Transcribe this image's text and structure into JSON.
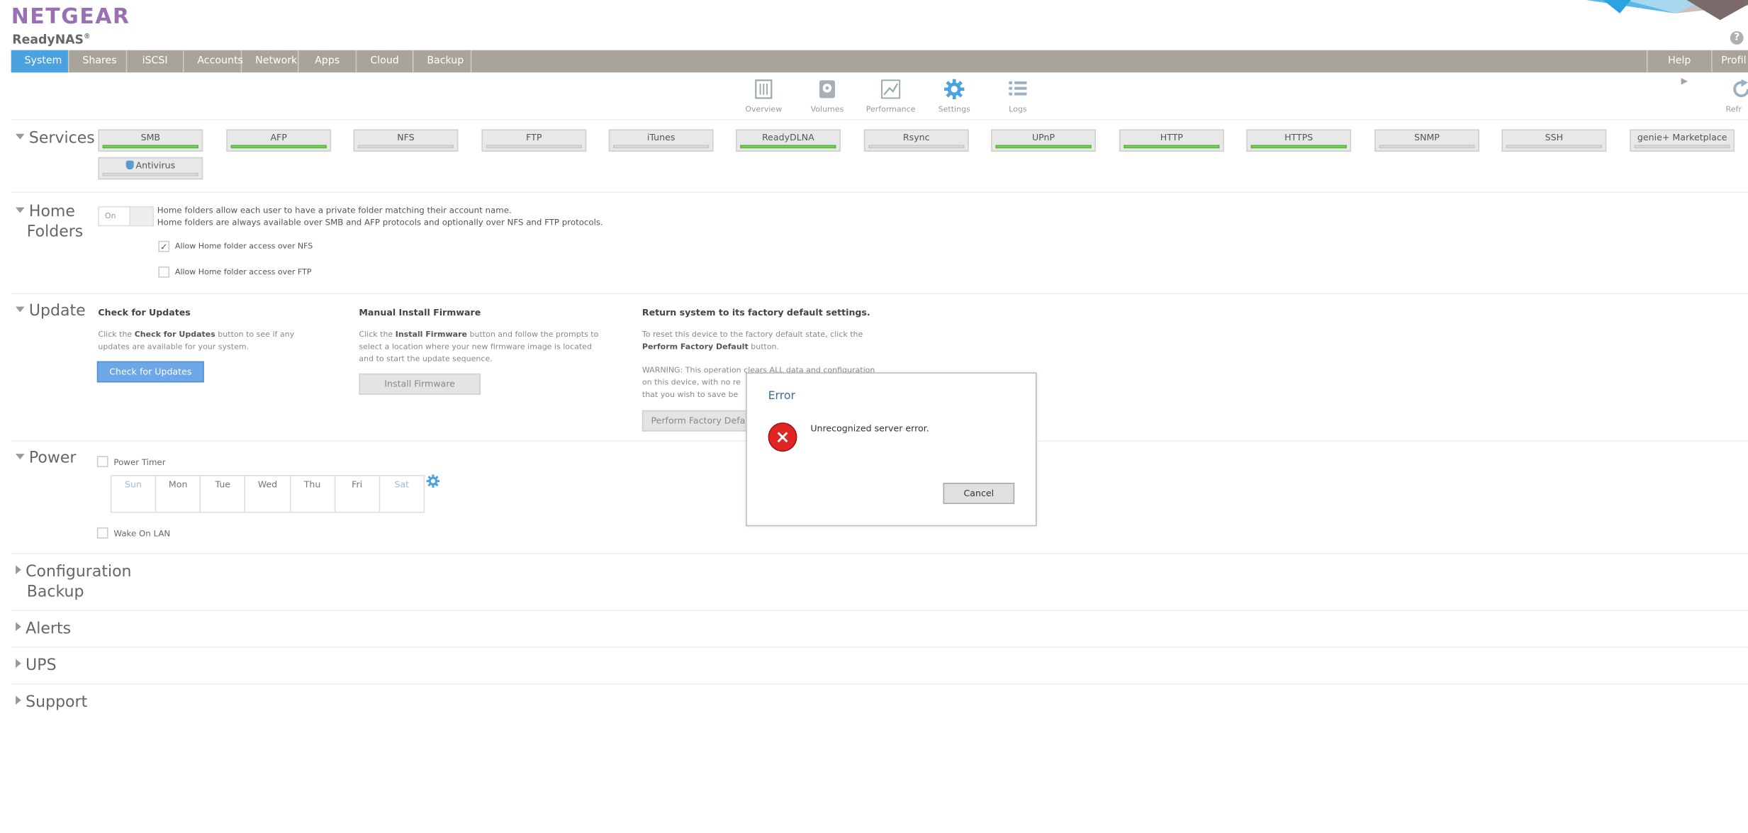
{
  "brand": {
    "logo": "NETGEAR",
    "product": "ReadyNAS",
    "product_mark": "®"
  },
  "help_icon": "?",
  "nav": {
    "tabs": [
      "System",
      "Shares",
      "iSCSI",
      "Accounts",
      "Network",
      "Apps",
      "Cloud",
      "Backup"
    ],
    "active": "System",
    "right": {
      "help": "Help",
      "profile": "Profil"
    }
  },
  "subnav": {
    "items": [
      "Overview",
      "Volumes",
      "Performance",
      "Settings",
      "Logs"
    ],
    "active": "Settings",
    "refresh": "Refr"
  },
  "services": {
    "title": "Services",
    "items": [
      {
        "label": "SMB",
        "enabled": true
      },
      {
        "label": "AFP",
        "enabled": true
      },
      {
        "label": "NFS",
        "enabled": false
      },
      {
        "label": "FTP",
        "enabled": false
      },
      {
        "label": "iTunes",
        "enabled": false
      },
      {
        "label": "ReadyDLNA",
        "enabled": true
      },
      {
        "label": "Rsync",
        "enabled": false
      },
      {
        "label": "UPnP",
        "enabled": true
      },
      {
        "label": "HTTP",
        "enabled": true
      },
      {
        "label": "HTTPS",
        "enabled": true
      },
      {
        "label": "SNMP",
        "enabled": false
      },
      {
        "label": "SSH",
        "enabled": false
      },
      {
        "label": "genie+ Marketplace",
        "enabled": false
      },
      {
        "label": "Antivirus",
        "enabled": false
      }
    ]
  },
  "home_folders": {
    "title_line1": "Home",
    "title_line2": "Folders",
    "toggle": "On",
    "desc_line1": "Home folders allow each user to have a private folder matching their account name.",
    "desc_line2": "Home folders are always available over SMB and AFP protocols and optionally over NFS and FTP protocols.",
    "nfs_label": "Allow Home folder access over NFS",
    "nfs_checked": true,
    "ftp_label": "Allow Home folder access over FTP",
    "ftp_checked": false
  },
  "update": {
    "title": "Update",
    "check": {
      "heading": "Check for Updates",
      "text_a": "Click the ",
      "text_b": "Check for Updates",
      "text_c": " button to see if any",
      "text_d": "updates are available for your system.",
      "button": "Check for Updates"
    },
    "manual": {
      "heading": "Manual Install Firmware",
      "text_a": "Click the ",
      "text_b": "Install Firmware",
      "text_c": " button and follow the prompts to",
      "text_d": "select a location where your new firmware image is located",
      "text_e": "and to start the update sequence.",
      "button": "Install Firmware"
    },
    "factory": {
      "heading": "Return system to its factory default settings.",
      "text_a": "To reset this device to the factory default state, click the",
      "text_b": "Perform Factory Default",
      "text_c": " button.",
      "warn_a": "WARNING: This operation clears ALL data and configuration",
      "warn_b": "on this device, with no re",
      "warn_c": "that you wish to save be",
      "button": "Perform Factory Defau"
    }
  },
  "power": {
    "title": "Power",
    "timer_label": "Power Timer",
    "days": [
      "Sun",
      "Mon",
      "Tue",
      "Wed",
      "Thu",
      "Fri",
      "Sat"
    ],
    "wol_label": "Wake On LAN"
  },
  "collapsed_sections": {
    "config_line1": "Configuration",
    "config_line2": "Backup",
    "alerts": "Alerts",
    "ups": "UPS",
    "support": "Support"
  },
  "dialog": {
    "title": "Error",
    "message": "Unrecognized server error.",
    "cancel": "Cancel",
    "icon": "×"
  },
  "colors": {
    "brand": "#9b6fb4",
    "accent": "#4aa3df",
    "navbar": "#a9a49b",
    "enabled": "#7dd660",
    "error": "#e12424"
  }
}
